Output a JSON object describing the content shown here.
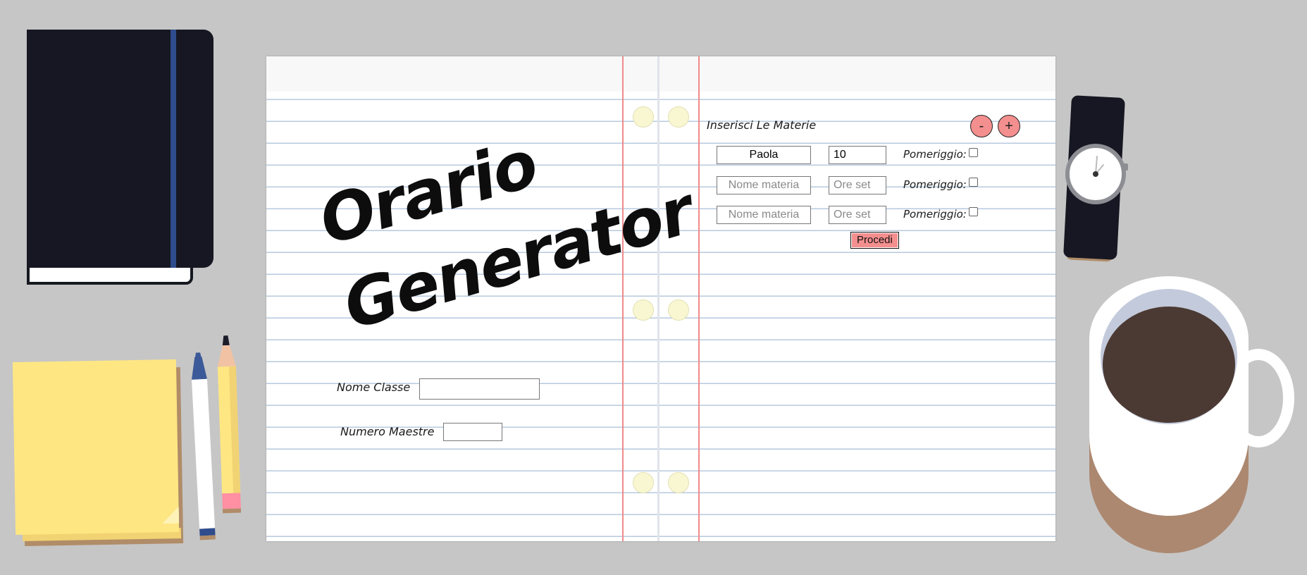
{
  "app": {
    "title_line1": "Orario",
    "title_line2": "Generator"
  },
  "class_form": {
    "class_name_label": "Nome Classe",
    "class_name_value": "",
    "teachers_label": "Numero Maestre",
    "teachers_value": ""
  },
  "subjects": {
    "heading": "Inserisci Le Materie",
    "remove_button": "-",
    "add_button": "+",
    "afternoon_label": "Pomeriggio:",
    "name_placeholder": "Nome materia",
    "hours_placeholder": "Ore set",
    "rows": [
      {
        "name": "Paola",
        "hours": "10",
        "afternoon": false
      },
      {
        "name": "",
        "hours": "",
        "afternoon": false
      },
      {
        "name": "",
        "hours": "",
        "afternoon": false
      }
    ],
    "submit_button": "Procedi"
  },
  "colors": {
    "background": "#c6c6c6",
    "accent_button": "#f48f8f",
    "margin_line": "#f08a8a",
    "ruled_line": "#b7c9df",
    "notebook": "#161722",
    "notebook_band": "#2f4c8c",
    "sticky_note": "#fee683",
    "coffee": "#4b3a33"
  },
  "icons": [
    "notebook-icon",
    "sticky-note-icon",
    "pen-icon",
    "pencil-icon",
    "watch-icon",
    "coffee-mug-icon"
  ]
}
